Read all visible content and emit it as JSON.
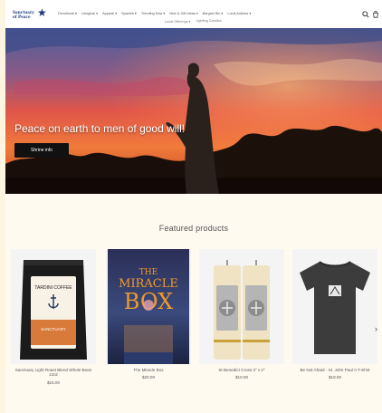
{
  "header": {
    "logo_line1": "Sanctuary",
    "logo_line2": "of Peace",
    "nav": [
      "Devotional ▾",
      "Liturgical ▾",
      "Apparel ▾",
      "Spanish ▾",
      "Trending Now ▾",
      "New & Gift Ideas ▾",
      "Bargain Bin ▾",
      "Local Authors ▾"
    ],
    "nav_row2": [
      "Local Offerings ▾",
      "Lighting Candles"
    ]
  },
  "hero": {
    "title": "Peace on earth to men of good will!",
    "button": "Shrine info"
  },
  "featured": {
    "title": "Featured products",
    "products": [
      {
        "name": "Sanctuary Light Roast Blend Whole Bean 12oz",
        "price": "$15.00"
      },
      {
        "name": "The Miracle Box",
        "price": "$20.00"
      },
      {
        "name": "St Benedict Cross 3\" x 2\"",
        "price": "$10.00"
      },
      {
        "name": "Be Not Afraid - St. John Paul II T-Shirt",
        "price": "$18.00"
      }
    ]
  },
  "images": {
    "coffee_label_brand": "TARDINI COFFEE",
    "coffee_label_flavor": "SANCTUARY",
    "book_line1": "THE",
    "book_line2": "MIRACLE",
    "book_line3": "BOX"
  },
  "colors": {
    "page_bg": "#fdf5df",
    "nav_text": "#555555",
    "button_bg": "#111111",
    "accent_blue": "#1f3a7a"
  }
}
